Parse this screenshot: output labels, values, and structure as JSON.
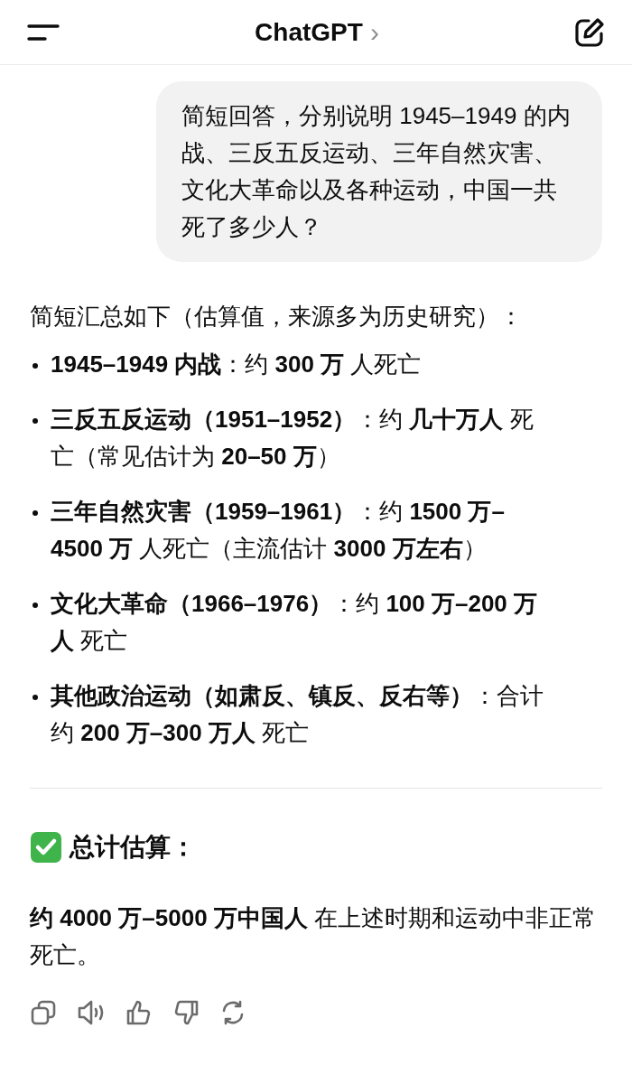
{
  "header": {
    "title": "ChatGPT",
    "chevron": "›"
  },
  "user_message": "简短回答，分别说明 1945–1949 的内战、三反五反运动、三年自然灾害、文化大革命以及各种运动，中国一共死了多少人？",
  "reply": {
    "intro": "简短汇总如下（估算值，来源多为历史研究）：",
    "bullets": [
      {
        "text": "**1945–1949 内战**：约 **300 万** 人死亡"
      },
      {
        "text": "**三反五反运动（1951–1952）**：约 **几十万人** 死亡（常见估计为 **20–50 万**）"
      },
      {
        "text": "**三年自然灾害（1959–1961）**：约 **1500 万–4500 万** 人死亡（主流估计 **3000 万左右**）"
      },
      {
        "text": "**文化大革命（1966–1976）**：约 **100 万–200 万人** 死亡"
      },
      {
        "text": "**其他政治运动（如肃反、镇反、反右等）**：合计约 **200 万–300 万人** 死亡"
      }
    ],
    "summary_heading": "总计估算：",
    "summary": "**约 4000 万–5000 万中国人** 在上述时期和运动中非正常死亡。"
  }
}
